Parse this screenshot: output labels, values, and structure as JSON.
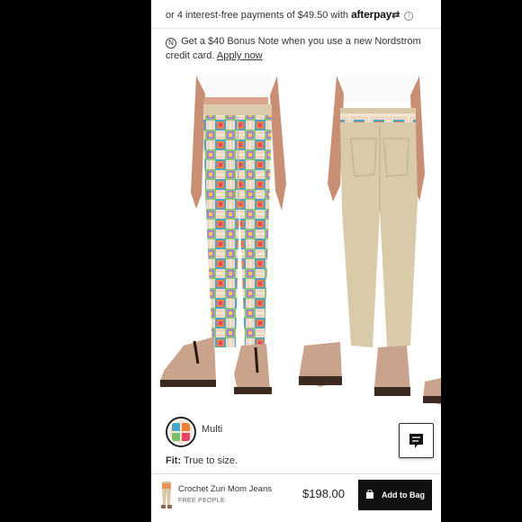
{
  "afterpay": {
    "text": "or 4 interest-free payments of $49.50 with",
    "brand": "afterpay",
    "info_glyph": "i"
  },
  "bonus": {
    "text": "Get a $40 Bonus Note when you use a new Nordstrom credit card.",
    "link": "Apply now",
    "card_glyph": "N"
  },
  "swatch": {
    "label": "Multi"
  },
  "fit": {
    "label": "Fit:",
    "value": "True to size."
  },
  "bottom_bar": {
    "product_name": "Crochet Zuri Mom Jeans",
    "brand": "FREE PEOPLE",
    "price": "$198.00",
    "add_to_bag": "Add to Bag"
  },
  "colors": {
    "background": "#000000",
    "button": "#111111",
    "khaki": "#d9cba9",
    "crochet_base": "#f3e6d4"
  },
  "icons": [
    "info-icon",
    "card-icon",
    "chat-icon",
    "bag-icon"
  ]
}
